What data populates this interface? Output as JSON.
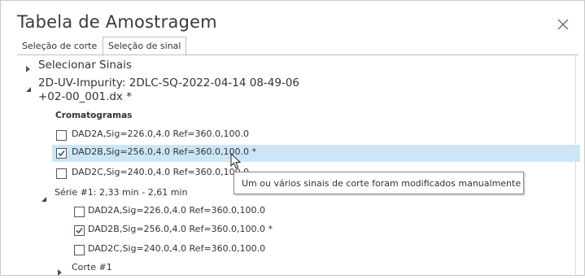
{
  "window": {
    "title": "Tabela de Amostragem"
  },
  "tabs": [
    {
      "label": "Seleção de corte"
    },
    {
      "label": "Seleção de sinal"
    }
  ],
  "tree": {
    "select_signals": "Selecionar Sinais",
    "file_line1": "2D-UV-Impurity: 2DLC-SQ-2022-04-14 08-49-06",
    "file_line2": "+02-00_001.dx *",
    "chromatograms_heading": "Cromatogramas",
    "chromatograms": [
      {
        "label": "DAD2A,Sig=226.0,4.0  Ref=360.0,100.0",
        "checked": false
      },
      {
        "label": "DAD2B,Sig=256.0,4.0  Ref=360.0,100.0",
        "checked": true,
        "modified_marker": "*"
      },
      {
        "label": "DAD2C,Sig=240.0,4.0  Ref=360.0,100.0",
        "checked": false
      }
    ],
    "series_label": "Série #1: 2,33 min - 2,61 min",
    "series_items": [
      {
        "label": "DAD2A,Sig=226.0,4.0  Ref=360.0,100.0",
        "checked": false
      },
      {
        "label": "DAD2B,Sig=256.0,4.0  Ref=360.0,100.0",
        "checked": true,
        "modified_marker": "*"
      },
      {
        "label": "DAD2C,Sig=240.0,4.0  Ref=360.0,100.0",
        "checked": false
      }
    ],
    "cut_label": "Corte #1"
  },
  "tooltip": {
    "text": "Um ou vários sinais de corte foram modificados manualmente"
  },
  "colors": {
    "selection": "#cde6f7",
    "checkmark": "#1f5f99"
  }
}
